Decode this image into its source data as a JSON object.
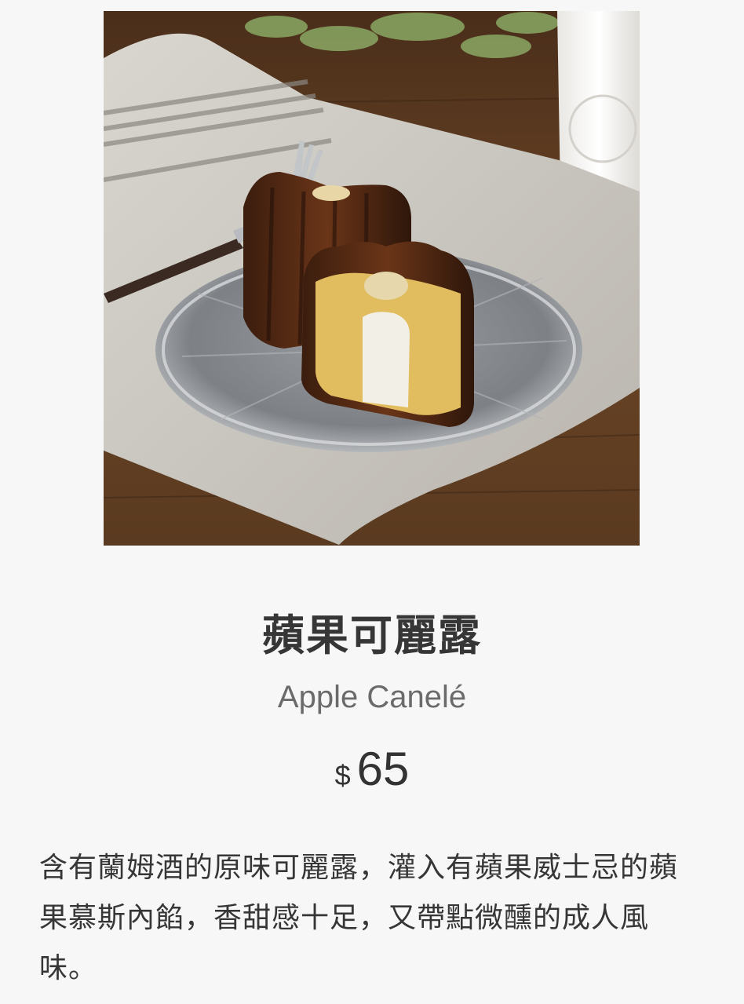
{
  "product": {
    "image_alt": "Apple Canelé photo",
    "name_zh": "蘋果可麗露",
    "name_en": "Apple Canelé",
    "currency": "$",
    "price": "65",
    "description": "含有蘭姆酒的原味可麗露，灌入有蘋果威士忌的蘋果慕斯內餡，香甜感十足，又帶點微醺的成人風味。"
  },
  "colors": {
    "background": "#f7f7f7",
    "text": "#363636",
    "subtitle": "#6b6b6b"
  }
}
